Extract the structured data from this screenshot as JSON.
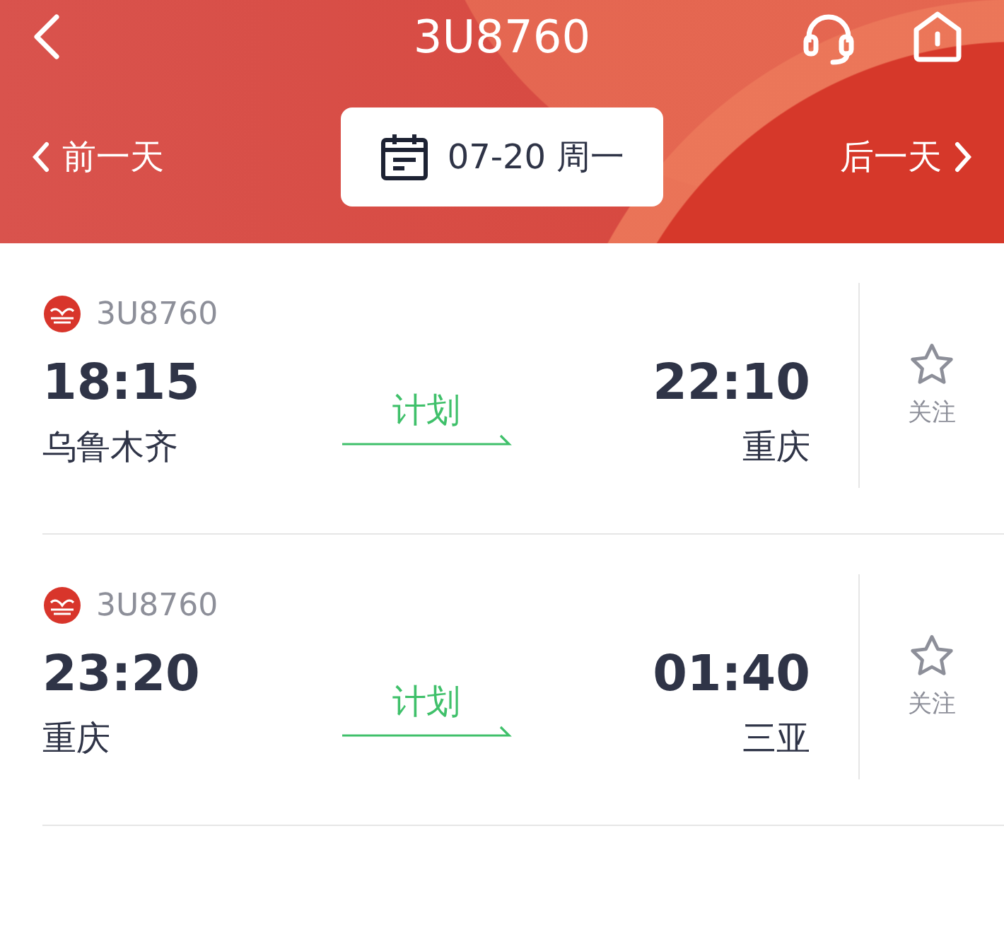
{
  "header": {
    "title": "3U8760",
    "prev_day": "前一天",
    "date": "07-20 周一",
    "next_day": "后一天"
  },
  "flights": [
    {
      "flight_no": "3U8760",
      "depart_time": "18:15",
      "depart_city": "乌鲁木齐",
      "status": "计划",
      "arrive_time": "22:10",
      "arrive_city": "重庆",
      "follow_label": "关注",
      "followed": false
    },
    {
      "flight_no": "3U8760",
      "depart_time": "23:20",
      "depart_city": "重庆",
      "status": "计划",
      "arrive_time": "01:40",
      "arrive_city": "三亚",
      "follow_label": "关注",
      "followed": false
    }
  ]
}
